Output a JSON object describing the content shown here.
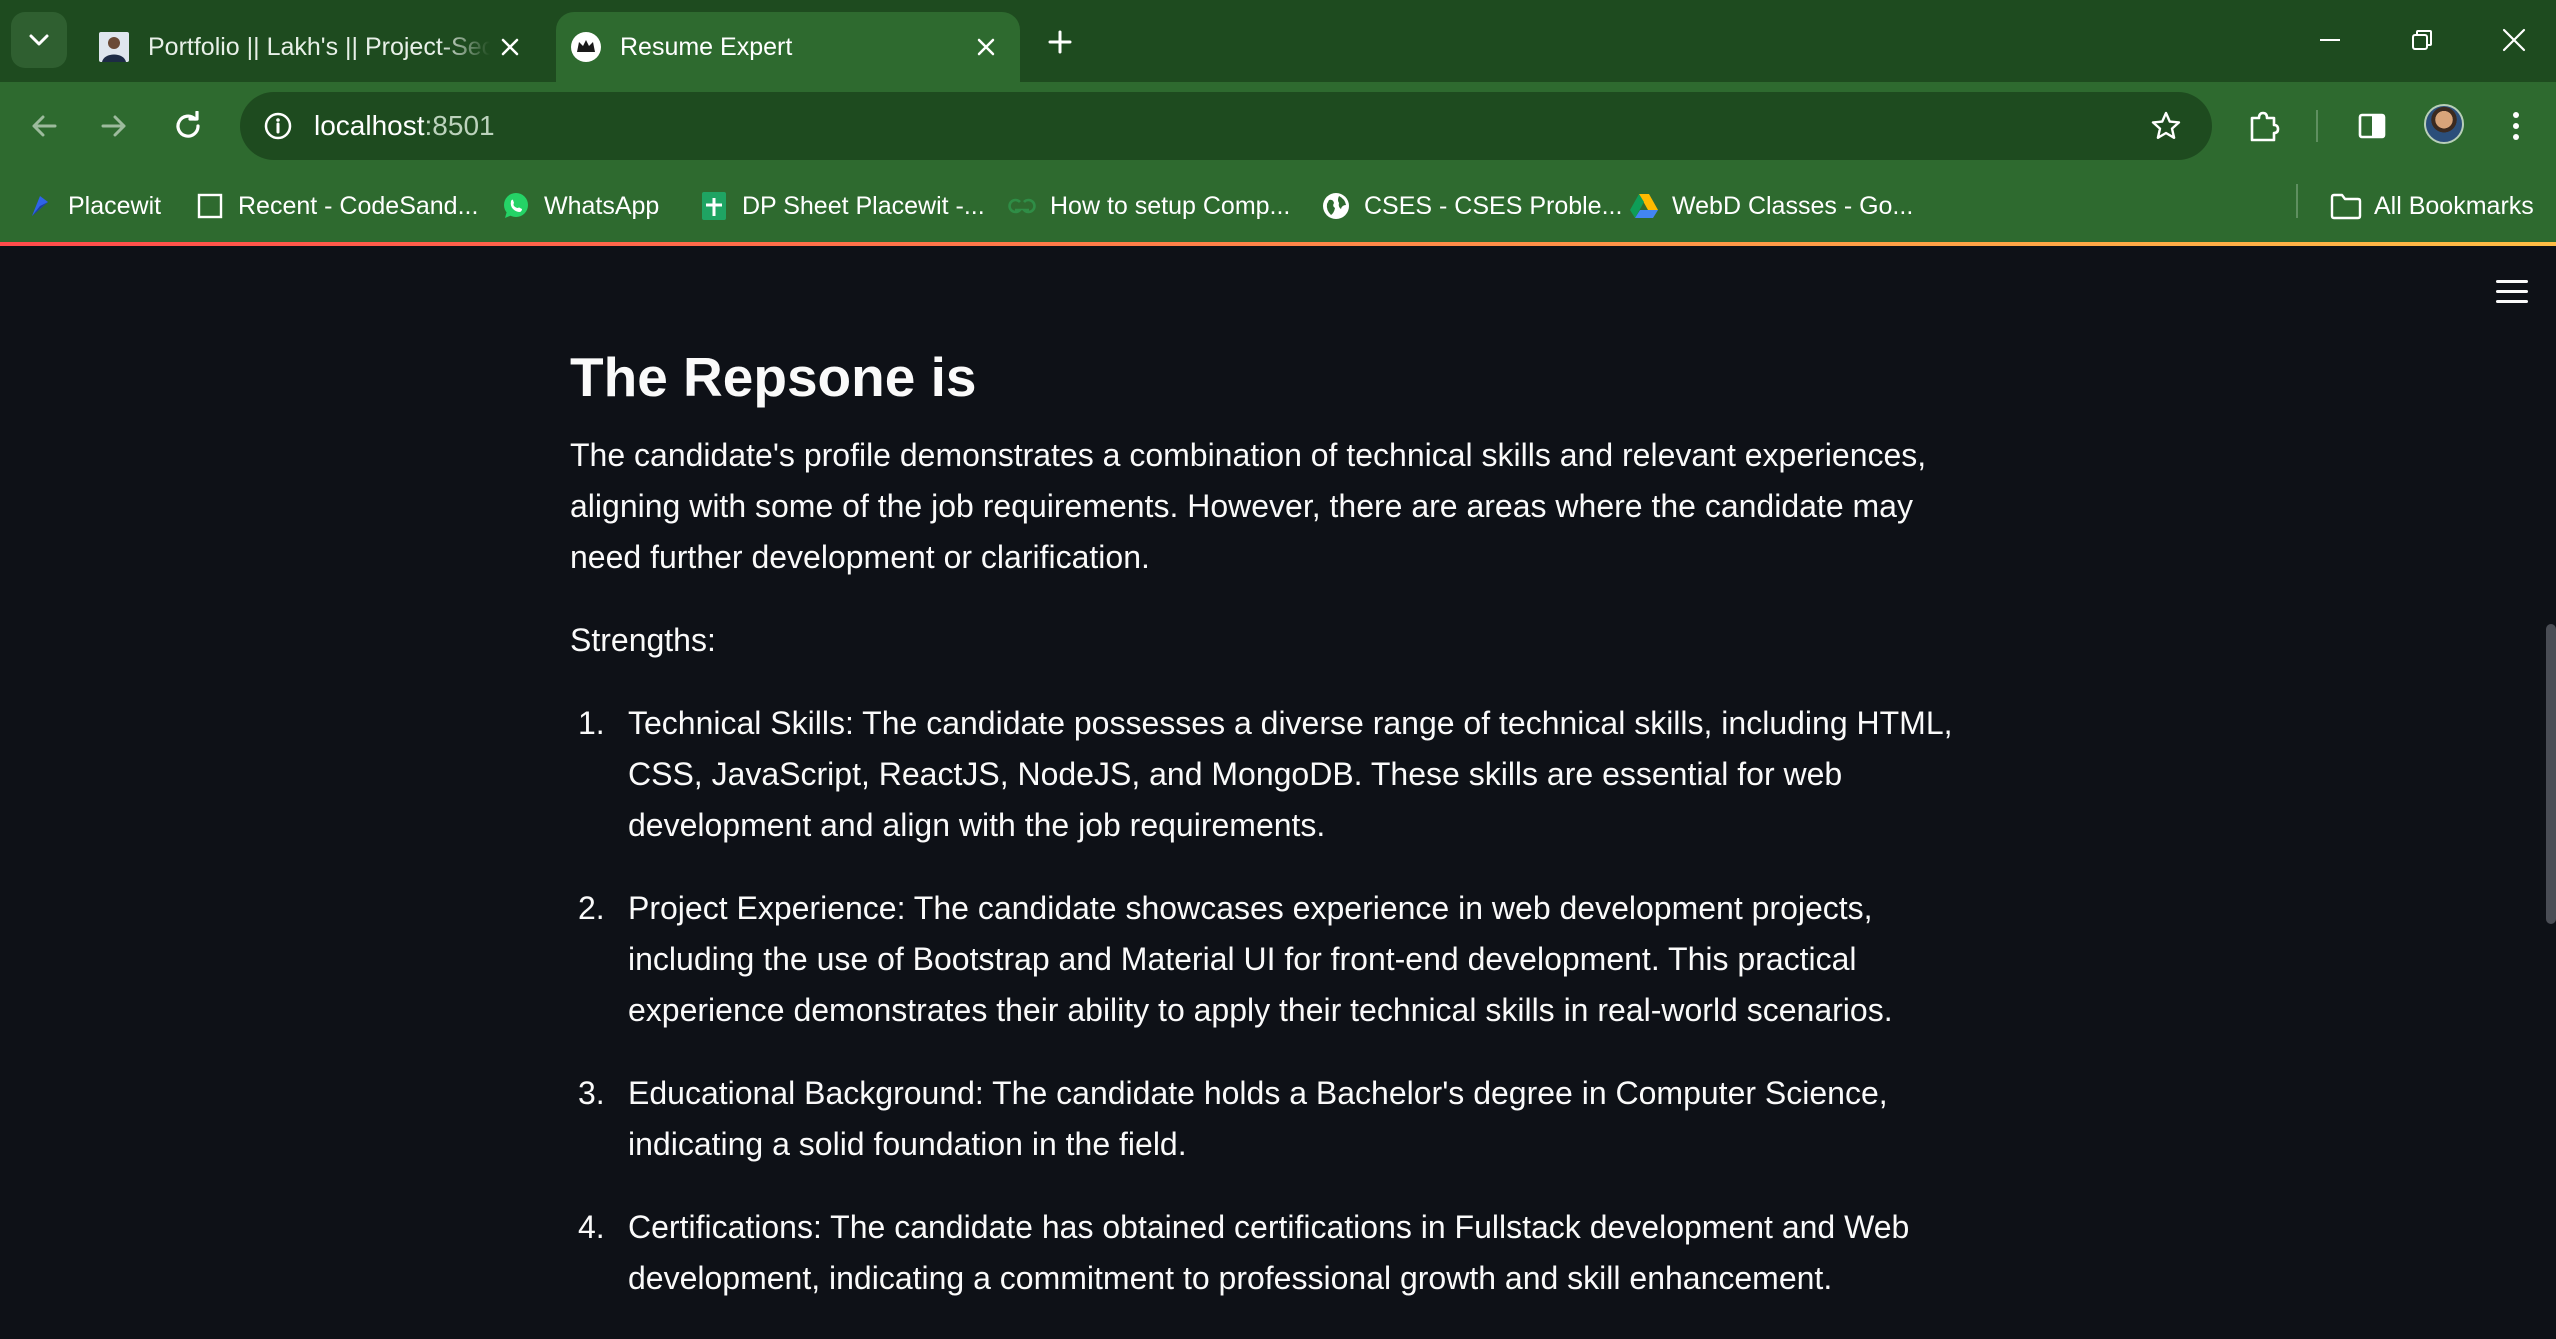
{
  "browser": {
    "tabs": [
      {
        "title": "Portfolio || Lakh's || Project-Section",
        "active": false
      },
      {
        "title": "Resume Expert",
        "active": true
      }
    ],
    "address": {
      "host": "localhost",
      "port": ":8501"
    },
    "bookmarks": [
      {
        "label": "Placewit",
        "icon": "placewit-icon"
      },
      {
        "label": "Recent - CodeSand...",
        "icon": "codesandbox-icon"
      },
      {
        "label": "WhatsApp",
        "icon": "whatsapp-icon"
      },
      {
        "label": "DP Sheet Placewit -...",
        "icon": "sheets-icon"
      },
      {
        "label": "How to setup Comp...",
        "icon": "gfg-icon"
      },
      {
        "label": "CSES - CSES Proble...",
        "icon": "globe-icon"
      },
      {
        "label": "WebD Classes - Go...",
        "icon": "drive-icon"
      }
    ],
    "all_bookmarks": "All Bookmarks",
    "colors": {
      "frame": "#1e4b1f",
      "toolbar": "#2e6a2f"
    }
  },
  "page": {
    "heading": "The Repsone is",
    "intro": "The candidate's profile demonstrates a combination of technical skills and relevant experiences, aligning with some of the job requirements. However, there are areas where the candidate may need further development or clarification.",
    "strengths_label": "Strengths:",
    "strengths": [
      {
        "num": "1.",
        "text": "Technical Skills: The candidate possesses a diverse range of technical skills, including HTML, CSS, JavaScript, ReactJS, NodeJS, and MongoDB. These skills are essential for web development and align with the job requirements."
      },
      {
        "num": "2.",
        "text": "Project Experience: The candidate showcases experience in web development projects, including the use of Bootstrap and Material UI for front-end development. This practical experience demonstrates their ability to apply their technical skills in real-world scenarios."
      },
      {
        "num": "3.",
        "text": "Educational Background: The candidate holds a Bachelor's degree in Computer Science, indicating a solid foundation in the field."
      },
      {
        "num": "4.",
        "text": "Certifications: The candidate has obtained certifications in Fullstack development and Web development, indicating a commitment to professional growth and skill enhancement."
      }
    ],
    "colors": {
      "background": "#0e1117",
      "text": "#fafafa",
      "accent": "#ff4b4b"
    }
  }
}
